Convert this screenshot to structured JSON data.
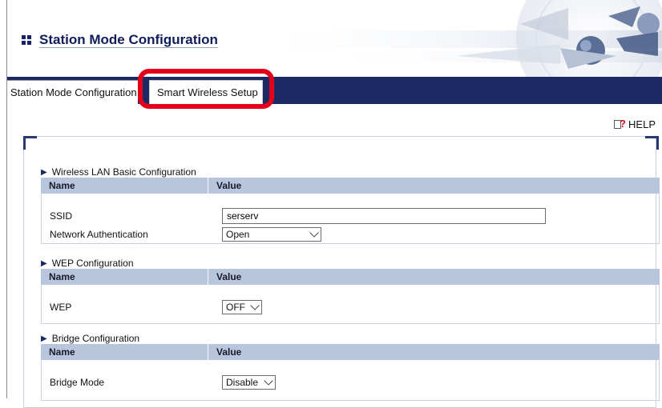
{
  "header": {
    "title": "Station Mode Configuration"
  },
  "tabs": [
    {
      "label": "Station Mode Configuration"
    },
    {
      "label": "Smart Wireless Setup"
    }
  ],
  "help": {
    "label": "HELP"
  },
  "sections": [
    {
      "title": "Wireless LAN Basic Configuration",
      "col_name": "Name",
      "col_value": "Value",
      "rows": [
        {
          "label": "SSID",
          "value": "serserv"
        },
        {
          "label": "Network Authentication",
          "value": "Open"
        }
      ]
    },
    {
      "title": "WEP Configuration",
      "col_name": "Name",
      "col_value": "Value",
      "rows": [
        {
          "label": "WEP",
          "value": "OFF"
        }
      ]
    },
    {
      "title": "Bridge Configuration",
      "col_name": "Name",
      "col_value": "Value",
      "rows": [
        {
          "label": "Bridge Mode",
          "value": "Disable"
        }
      ]
    }
  ],
  "colors": {
    "navy": "#1c2a63",
    "header_row": "#b7c6dd",
    "highlight": "#e2001a"
  }
}
